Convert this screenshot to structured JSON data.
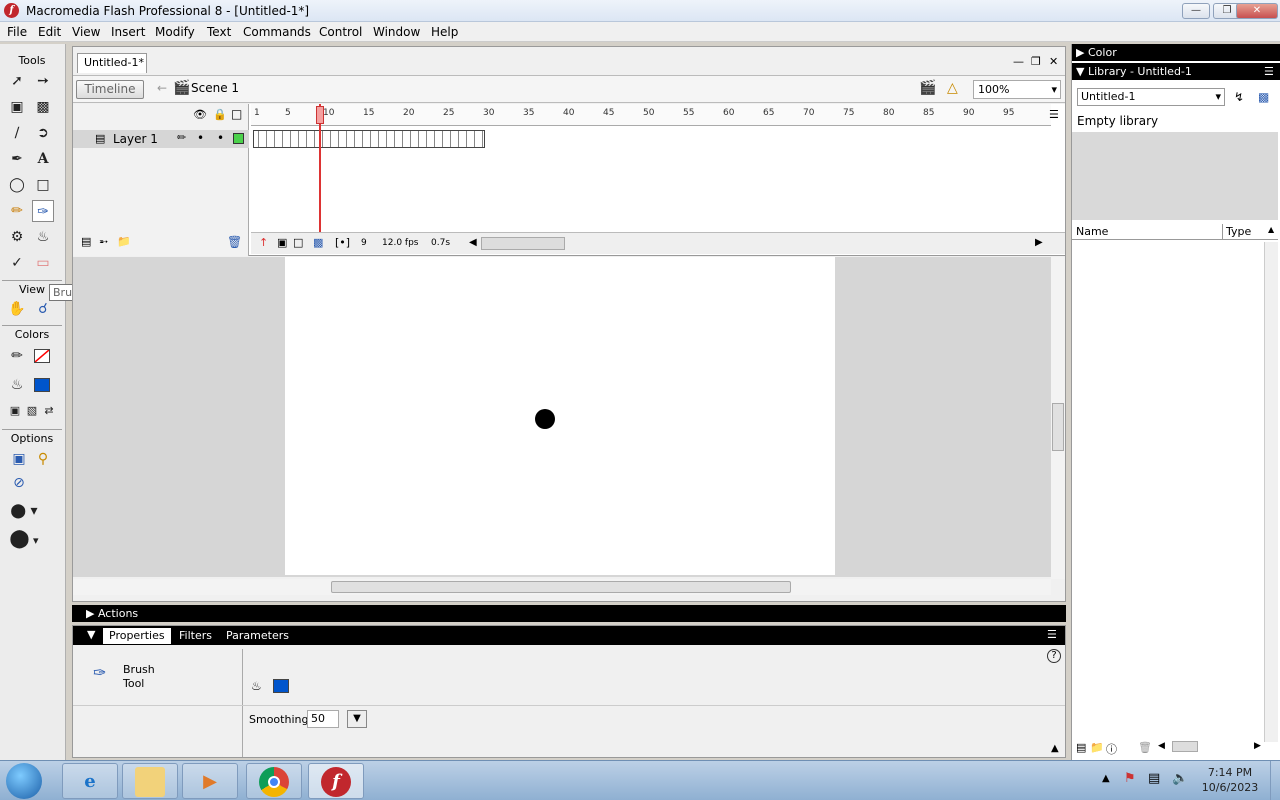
{
  "window": {
    "title": "Macromedia Flash Professional 8 - [Untitled-1*]"
  },
  "menu": [
    "File",
    "Edit",
    "View",
    "Insert",
    "Modify",
    "Text",
    "Commands",
    "Control",
    "Window",
    "Help"
  ],
  "tools_panel": {
    "header": "Tools",
    "view_label": "View",
    "colors_label": "Colors",
    "options_label": "Options",
    "tooltip": "Brush Tool (B)",
    "stroke_color": "#ff0000",
    "fill_color": "#0055cc"
  },
  "document": {
    "tab": "Untitled-1*",
    "timeline_button": "Timeline",
    "scene": "Scene 1",
    "zoom": "100%",
    "layer_name": "Layer 1",
    "frame_numbers": [
      "1",
      "5",
      "10",
      "15",
      "20",
      "25",
      "30",
      "35",
      "40",
      "45",
      "50",
      "55",
      "60",
      "65",
      "70",
      "75",
      "80",
      "85",
      "90",
      "95"
    ],
    "current_frame": "9",
    "frame_rate": "12.0 fps",
    "elapsed": "0.7s"
  },
  "actions_panel": {
    "label": "Actions"
  },
  "properties_panel": {
    "tabs": [
      "Properties",
      "Filters",
      "Parameters"
    ],
    "tool_name_line1": "Brush",
    "tool_name_line2": "Tool",
    "smoothing_label": "Smoothing",
    "smoothing_value": "50",
    "help": "?"
  },
  "right_panel": {
    "color_label": "Color",
    "library_label": "Library - Untitled-1",
    "library_select": "Untitled-1",
    "empty_text": "Empty library",
    "col_name": "Name",
    "col_type": "Type"
  },
  "taskbar": {
    "time": "7:14 PM",
    "date": "10/6/2023"
  }
}
